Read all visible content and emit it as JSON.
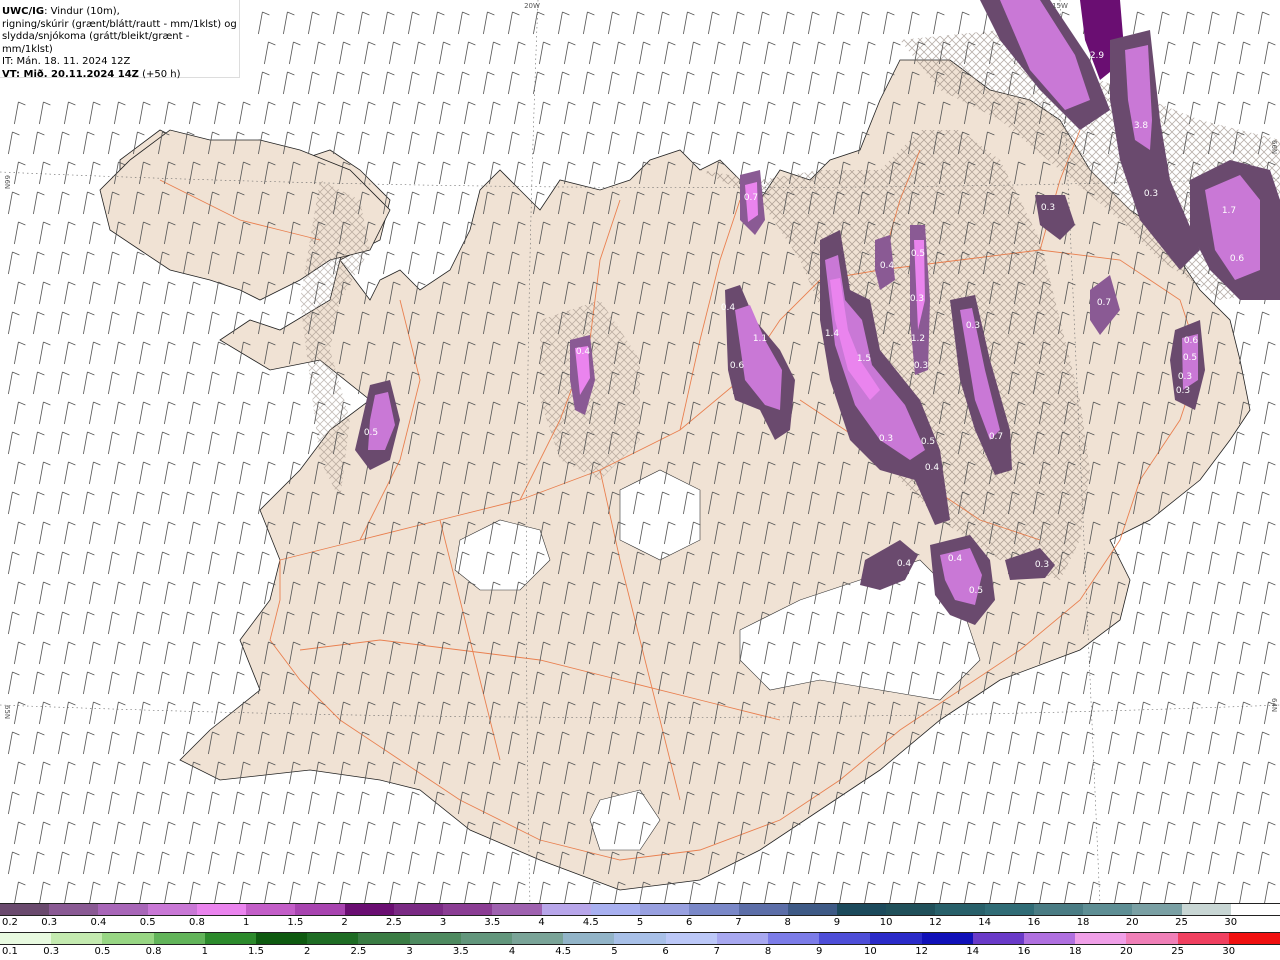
{
  "header": {
    "product": "UWC/IG",
    "line1_rest": ": Vindur (10m),",
    "line2": "rigning/skúrir (grænt/blátt/rautt - mm/1klst) og",
    "line3": "slydda/snjókoma (grátt/bleikt/grænt - mm/1klst)",
    "it_label": "IT",
    "it_value": ": Mán. 18. 11. 2024 12Z",
    "vt_label": "VT",
    "vt_value": ": Mið. 20.11.2024 14Z",
    "vt_suffix": " (+50 h)"
  },
  "graticule_labels": {
    "lon_20w": "20W",
    "lon_15w": "15W",
    "lat_66n_left": "66N",
    "lat_65n_left": "65N",
    "lat_66n_right": "66N",
    "lat_64n_right": "64N"
  },
  "precip_values": [
    {
      "label": "2.9"
    },
    {
      "label": "3.8"
    },
    {
      "label": "0.3"
    },
    {
      "label": "1.7"
    },
    {
      "label": "0.6"
    },
    {
      "label": "0.3"
    },
    {
      "label": "0.7"
    },
    {
      "label": "0.5"
    },
    {
      "label": "0.6"
    },
    {
      "label": "0.3"
    },
    {
      "label": "0.3"
    },
    {
      "label": "0.4"
    },
    {
      "label": "0.5"
    },
    {
      "label": "0.3"
    },
    {
      "label": "1.2"
    },
    {
      "label": "0.3"
    },
    {
      "label": "0.3"
    },
    {
      "label": "0.7"
    },
    {
      "label": "1.4"
    },
    {
      "label": "1.5"
    },
    {
      "label": "0.3"
    },
    {
      "label": "0.5"
    },
    {
      "label": "0.4"
    },
    {
      "label": "0.4"
    },
    {
      "label": "1.1"
    },
    {
      "label": "0.6"
    },
    {
      "label": "0.4"
    },
    {
      "label": "0.7"
    },
    {
      "label": "0.5"
    },
    {
      "label": "0.4"
    },
    {
      "label": "0.4"
    },
    {
      "label": "0.5"
    },
    {
      "label": "0.3"
    }
  ],
  "legend_snow": {
    "labels": [
      "0.2",
      "0.3",
      "0.4",
      "0.5",
      "0.8",
      "1",
      "1.5",
      "2",
      "2.5",
      "3",
      "3.5",
      "4",
      "4.5",
      "5",
      "6",
      "7",
      "8",
      "9",
      "10",
      "12",
      "14",
      "16",
      "18",
      "20",
      "25",
      "30"
    ],
    "colors": [
      "#6a4a6e",
      "#8a5a94",
      "#a866b8",
      "#c978d6",
      "#ea84ee",
      "#c35ec8",
      "#a844b0",
      "#6a0e72",
      "#7a2a84",
      "#8b3d94",
      "#9f62b0",
      "#b8a6ea",
      "#a8b0f0",
      "#98a0e0",
      "#7a88c8",
      "#5c6ea8",
      "#3e5a86",
      "#1c4a5c",
      "#20505a",
      "#28606a",
      "#306c76",
      "#4a7c84",
      "#5e8e94",
      "#7aa0a4",
      "#c8d6d4",
      "#ffffff"
    ]
  },
  "legend_rain": {
    "labels": [
      "0.1",
      "0.3",
      "0.5",
      "0.8",
      "1",
      "1.5",
      "2",
      "2.5",
      "3",
      "3.5",
      "4",
      "4.5",
      "5",
      "6",
      "7",
      "8",
      "9",
      "10",
      "12",
      "14",
      "16",
      "18",
      "20",
      "25",
      "30"
    ],
    "colors": [
      "#e8fae0",
      "#c4eab0",
      "#98d684",
      "#62b45a",
      "#2c8a2c",
      "#0e5a10",
      "#1e6c24",
      "#3a7c44",
      "#4e8a60",
      "#62967c",
      "#7aa498",
      "#92b4c8",
      "#a8c0e8",
      "#bcc8f8",
      "#a8a8f0",
      "#7c7ce8",
      "#4e4ed8",
      "#2a2ac8",
      "#1010b8",
      "#6a3ac8",
      "#b070e0",
      "#f0a0e8",
      "#f080b8",
      "#f04060",
      "#f01010"
    ]
  }
}
